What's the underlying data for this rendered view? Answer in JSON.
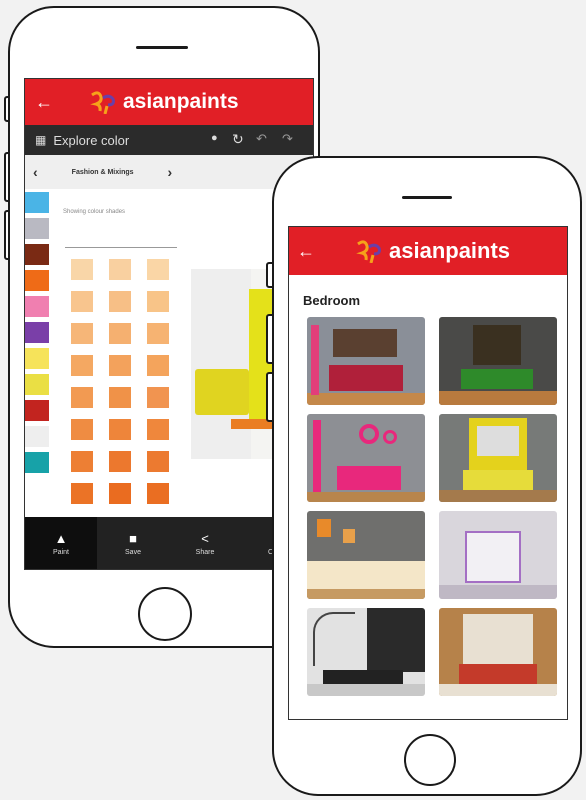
{
  "phone_left": {
    "header": {
      "back_icon": "back-arrow-icon",
      "brand": "asianpaints"
    },
    "toolbar": {
      "title": "Explore color",
      "icons": [
        "palette-icon",
        "refresh-icon",
        "undo-icon",
        "redo-icon"
      ]
    },
    "category_tab": {
      "label": "Fashion & Mixings",
      "prev_icon": "chevron-left-icon",
      "next_icon": "chevron-right-icon"
    },
    "sub_label": "Showing colour shades",
    "family_swatches": [
      "#4ab4e6",
      "#b9b9c2",
      "#7a2a14",
      "#ef6b17",
      "#f07fb0",
      "#7a3fa8",
      "#f6e35a",
      "#eadf44",
      "#c2241f",
      "#eeeeee",
      "#17a2a8"
    ],
    "shade_grid": [
      "#f9d6a8",
      "#f9d0a0",
      "#fad6a6",
      "#f8c58e",
      "#f7bf86",
      "#f8c488",
      "#f6b678",
      "#f5b070",
      "#f6b372",
      "#f4a862",
      "#f3a25c",
      "#f4a45c",
      "#f29a52",
      "#f09248",
      "#f19450",
      "#ef8c42",
      "#ee853a",
      "#ef873c",
      "#ed7f34",
      "#ec782e",
      "#ec7a30",
      "#eb7326",
      "#ea6c20",
      "#ea6e22"
    ],
    "bottom_nav": [
      {
        "label": "Paint",
        "icon": "paint-bucket-icon"
      },
      {
        "label": "Save",
        "icon": "save-icon"
      },
      {
        "label": "Share",
        "icon": "share-icon"
      },
      {
        "label": "Close",
        "icon": "close-icon"
      }
    ],
    "colors": {
      "header": "#e11f26",
      "toolbar": "#2b2b2b",
      "bottom_bar": "#222222",
      "preview_wall": "#e4e11a"
    }
  },
  "phone_right": {
    "header": {
      "back_icon": "back-arrow-icon",
      "brand": "asianpaints"
    },
    "section_title": "Bedroom",
    "gallery": [
      {
        "name": "bedroom-red-bed",
        "wall": "#8a8f98",
        "accent": "#b0203a",
        "floor": "#c4884a"
      },
      {
        "name": "bedroom-green-bed",
        "wall": "#4a4a48",
        "accent": "#2e8a2a",
        "floor": "#b87a3e"
      },
      {
        "name": "bedroom-pink-circles",
        "wall": "#8d8f94",
        "accent": "#e8287c",
        "floor": "#b8854c"
      },
      {
        "name": "bedroom-yellow-wall",
        "wall": "#777a78",
        "accent": "#e4d21c",
        "floor": "#a47a4c"
      },
      {
        "name": "bedroom-orange-frames",
        "wall": "#6f6f6d",
        "accent": "#e88a2a",
        "floor": "#c69a62"
      },
      {
        "name": "bedroom-purple-bunk",
        "wall": "#d9d6dc",
        "accent": "#a46fc4",
        "floor": "#bfb8c4"
      },
      {
        "name": "bedroom-tree-mural",
        "wall": "#e2e2e2",
        "accent": "#222222",
        "floor": "#c8c8c8"
      },
      {
        "name": "bedroom-wood-panel",
        "wall": "#b6824a",
        "accent": "#c43a2a",
        "floor": "#e8e0d2"
      }
    ]
  }
}
